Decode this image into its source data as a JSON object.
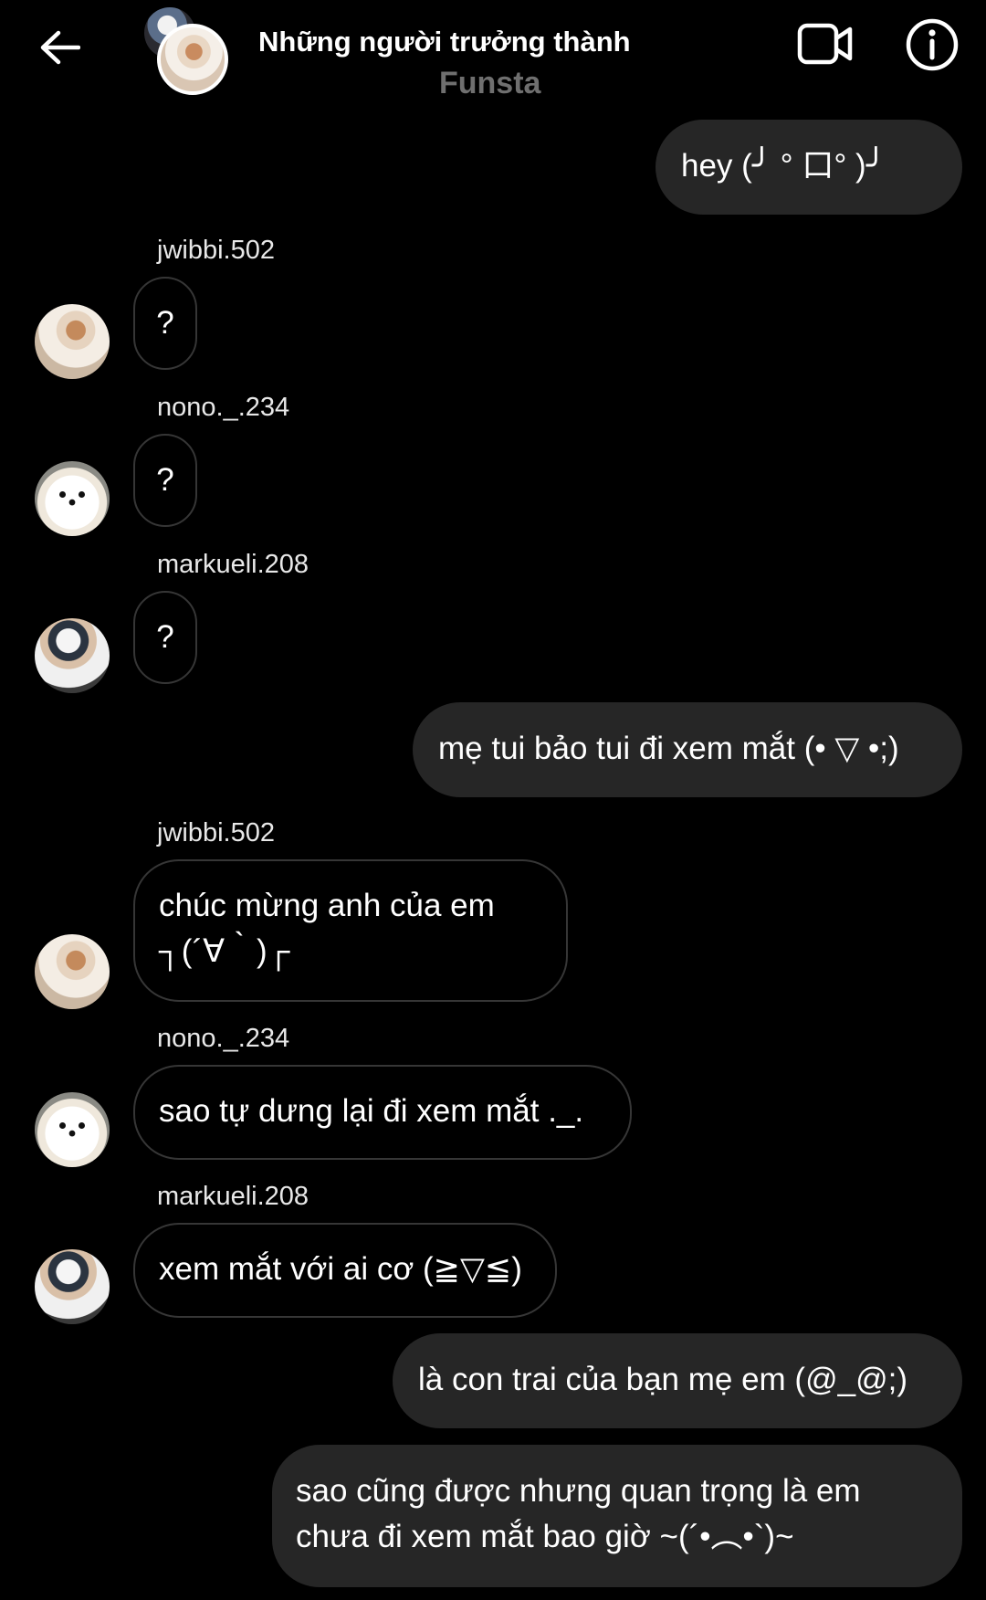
{
  "header": {
    "title": "Những người trưởng thành",
    "subtitle": "Funsta",
    "back_icon": "arrow-left-icon",
    "video_icon": "video-camera-icon",
    "info_icon": "info-icon"
  },
  "messages": [
    {
      "direction": "outgoing",
      "text": "hey (╯ ° 口°  )╯"
    },
    {
      "direction": "incoming",
      "sender": "jwibbi.502",
      "text": "?"
    },
    {
      "direction": "incoming",
      "sender": "nono._.234",
      "text": "?"
    },
    {
      "direction": "incoming",
      "sender": "markueli.208",
      "text": "?"
    },
    {
      "direction": "outgoing",
      "text": "mẹ tui bảo tui đi xem mắt (• ▽ •;)"
    },
    {
      "direction": "incoming",
      "sender": "jwibbi.502",
      "lines": [
        "chúc mừng anh của em",
        "┐(´∀｀)┌"
      ]
    },
    {
      "direction": "incoming",
      "sender": "nono._.234",
      "text": "sao tự dưng lại đi xem mắt ._."
    },
    {
      "direction": "incoming",
      "sender": "markueli.208",
      "text": "xem mắt với ai cơ (≧▽≦)"
    },
    {
      "direction": "outgoing",
      "text": "là con trai của bạn mẹ em (@_@;)"
    },
    {
      "direction": "outgoing",
      "lines": [
        "sao cũng được nhưng quan trọng là em",
        "chưa đi xem mắt bao giờ ~(´•︵•`)~"
      ]
    }
  ],
  "colors": {
    "background": "#000000",
    "outgoing_bubble": "#262626",
    "incoming_border": "#363636",
    "subtitle": "#6f6f6f"
  }
}
